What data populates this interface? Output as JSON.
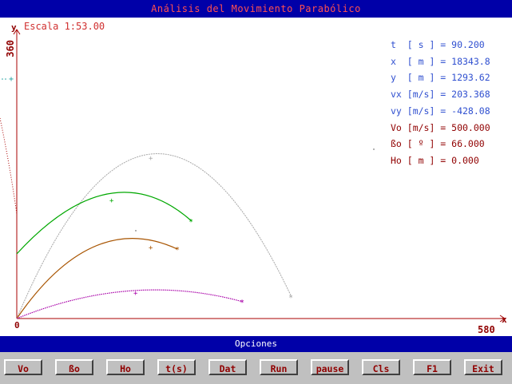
{
  "title": "Análisis del Movimiento Parabólico",
  "plot": {
    "scale": "Escala 1:53.00",
    "y_axis_name": "y",
    "y_max_label": "360",
    "x_axis_name": "x",
    "x_min_label": "0",
    "x_max_label": "580"
  },
  "readouts": [
    {
      "text": "t  [ s ] = 90.200",
      "color": "#3050d0"
    },
    {
      "text": "x  [ m ] = 18343.8",
      "color": "#3050d0"
    },
    {
      "text": "y  [ m ] = 1293.62",
      "color": "#3050d0"
    },
    {
      "text": "vx [m/s] = 203.368",
      "color": "#3050d0"
    },
    {
      "text": "vy [m/s] = -428.08",
      "color": "#3050d0"
    },
    {
      "text": "Vo [m/s] = 500.000",
      "color": "#900000"
    },
    {
      "text": "ßo [ º ] = 66.000",
      "color": "#900000"
    },
    {
      "text": "Ho [ m ] = 0.000",
      "color": "#900000"
    }
  ],
  "options_bar": "Opciones",
  "buttons": [
    "Vo",
    "ßo",
    "Ho",
    "t(s)",
    "Dat",
    "Run",
    "pause",
    "Cls",
    "F1",
    "Exit"
  ],
  "trajectory_colors": {
    "gray": "#a8a8a8",
    "green": "#00a800",
    "brown": "#a85400",
    "purple": "#a800a8",
    "red_dotted": "#a80000",
    "axes": "#a80000"
  }
}
